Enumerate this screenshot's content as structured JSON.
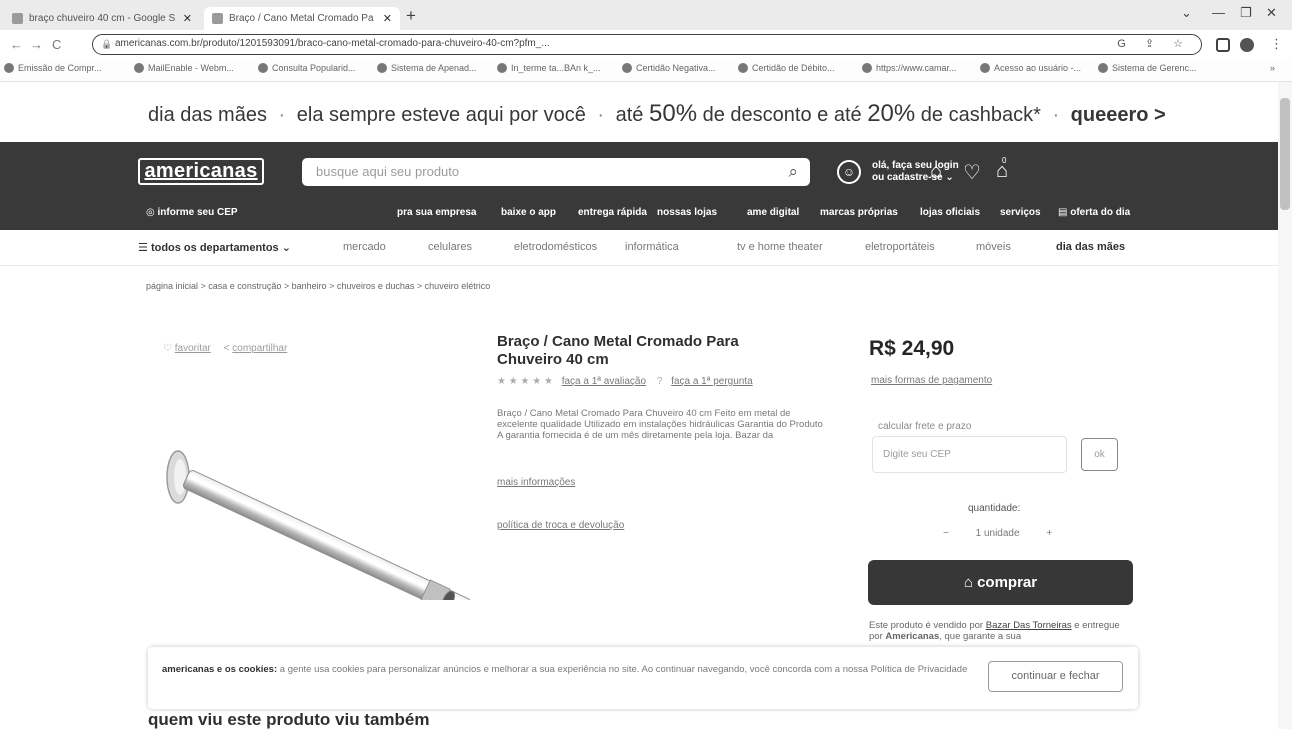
{
  "browser": {
    "tabs": [
      {
        "label": "braço chuveiro 40 cm - Google S"
      },
      {
        "label": "Braço / Cano Metal Cromado Pa"
      }
    ],
    "new_tab": "+",
    "url": "americanas.com.br/produto/1201593091/braco-cano-metal-cromado-para-chuveiro-40-cm?pfm_...",
    "bookmarks": [
      "Emissão de Compr...",
      "MailEnable - Webm...",
      "Consulta Popularid...",
      "Sistema de Apenad...",
      "In_terme ta...BAn k_...",
      "Certidão Negativa...",
      "Certidão de Débito...",
      "https://www.camar...",
      "Acesso ao usuário -...",
      "Sistema de Gerenc..."
    ]
  },
  "promo": {
    "part1": "dia das mães",
    "sep": "·",
    "part2": "ela sempre esteve aqui por você",
    "part3_pre": "até",
    "pct1": "50%",
    "part3_mid": "de desconto e até",
    "pct2": "20%",
    "part3_post": "de cashback*",
    "cta": "queeero >"
  },
  "header": {
    "logo": "americanas",
    "search_placeholder": "busque aqui seu produto",
    "login_line1": "olá, faça seu login",
    "login_line2": "ou cadastre-se",
    "cart_count": "0",
    "cep": "informe seu CEP",
    "sublinks": [
      "pra sua empresa",
      "baixe o app",
      "entrega rápida",
      "nossas lojas",
      "ame digital",
      "marcas próprias",
      "lojas oficiais",
      "serviços",
      "oferta do dia"
    ]
  },
  "departments": {
    "all": "todos os departamentos",
    "items": [
      "mercado",
      "celulares",
      "eletrodomésticos",
      "informática",
      "tv e home theater",
      "eletroportáteis",
      "móveis",
      "dia das mães"
    ]
  },
  "breadcrumb": "página inicial  >  casa e construção  >  banheiro  >  chuveiros e duchas  >  chuveiro elétrico",
  "actions": {
    "favorite": "favoritar",
    "share": "compartilhar"
  },
  "product": {
    "title": "Braço / Cano Metal Cromado Para Chuveiro 40 cm",
    "stars": "★ ★ ★ ★ ★",
    "review_link": "faça a 1ª avaliação",
    "question_link": "faça a 1ª pergunta",
    "description": "Braço / Cano Metal Cromado Para Chuveiro 40 cm     Feito em metal de excelente qualidade     Utilizado em instalações hidráulicas     Garantia do Produto     A garantia fornecida é de um mês diretamente pela loja. Bazar da",
    "more_info": "mais informações",
    "policy": "política de troca e devolução",
    "price": "R$ 24,90",
    "payment_more": "mais formas de pagamento",
    "shipping_label": "calcular frete e prazo",
    "cep_placeholder": "Digite seu CEP",
    "ok": "ok",
    "quantity_label": "quantidade:",
    "minus": "−",
    "quantity_value": "1 unidade",
    "plus": "+",
    "buy": "comprar",
    "seller_pre": "Este produto é vendido por",
    "seller_name": "Bazar Das Torneiras",
    "seller_mid": "e entregue por",
    "seller_delivery": "Americanas",
    "seller_post": ", que garante a sua"
  },
  "cookie": {
    "bold": "americanas e os cookies:",
    "text": "a gente usa cookies para personalizar anúncios e melhorar a sua experiência no site. Ao continuar navegando, você concorda com a nossa Política de Privacidade",
    "button": "continuar e fechar"
  },
  "also_viewed": "quem viu este produto viu também"
}
